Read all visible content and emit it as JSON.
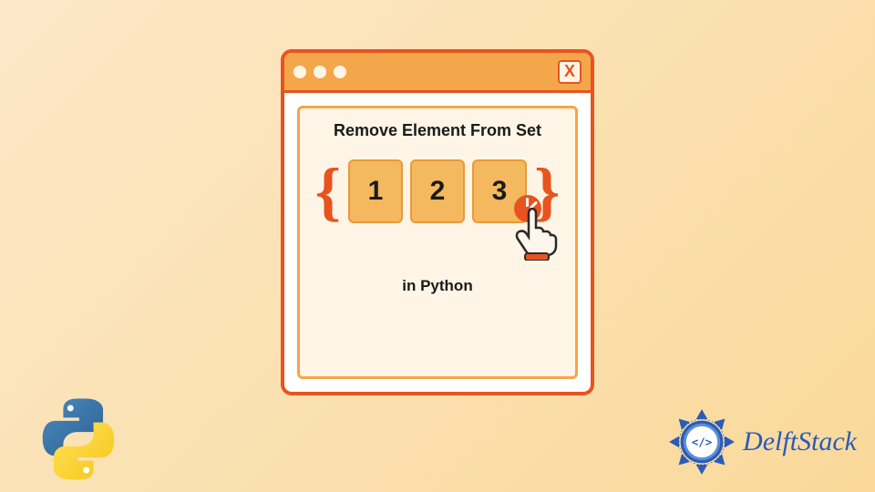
{
  "window": {
    "close_label": "X"
  },
  "content": {
    "heading": "Remove Element From Set",
    "subheading": "in Python",
    "set_items": [
      "1",
      "2",
      "3"
    ],
    "brace_open": "{",
    "brace_close": "}"
  },
  "branding": {
    "delft_text": "DelftStack"
  },
  "colors": {
    "accent": "#e8531f",
    "tile": "#f4b85e",
    "bg_light": "#fef5e6",
    "titlebar": "#f4a64a",
    "brand_blue": "#2a5bb8"
  }
}
